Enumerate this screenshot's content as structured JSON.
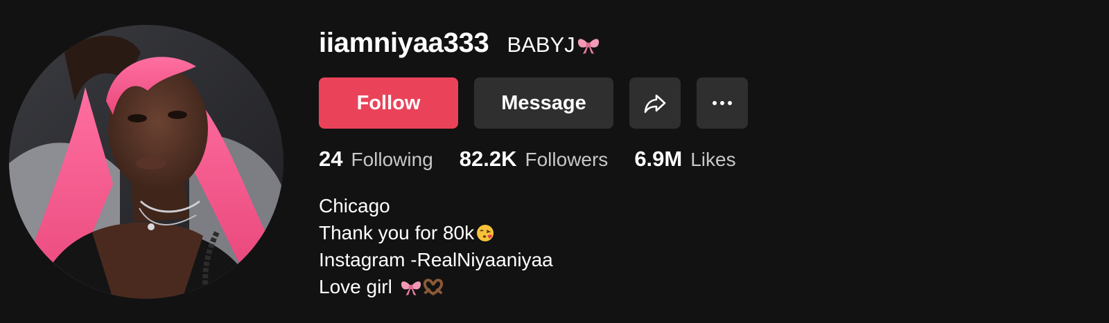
{
  "profile": {
    "username": "iiamniyaa333",
    "nickname": "BABYJ",
    "nickname_icon": "ribbon-bow-icon",
    "avatar_description": "profile-photo"
  },
  "actions": {
    "follow_label": "Follow",
    "message_label": "Message",
    "share_icon": "share-arrow-icon",
    "more_icon": "more-dots-icon"
  },
  "stats": {
    "following_count": "24",
    "following_label": "Following",
    "followers_count": "82.2K",
    "followers_label": "Followers",
    "likes_count": "6.9M",
    "likes_label": "Likes"
  },
  "bio": {
    "line1": "Chicago",
    "line2": "Thank you for 80k",
    "line2_icon": "kissing-face-emoji-icon",
    "line3": "Instagram -RealNiyaaniyaa",
    "line4": "Love girl ",
    "line4_icons": [
      "ribbon-bow-icon",
      "heart-hands-icon"
    ]
  },
  "colors": {
    "background": "#121212",
    "follow_button": "#ea4359",
    "secondary_button": "#2f2f2f",
    "stat_label": "#c8c8c8"
  }
}
